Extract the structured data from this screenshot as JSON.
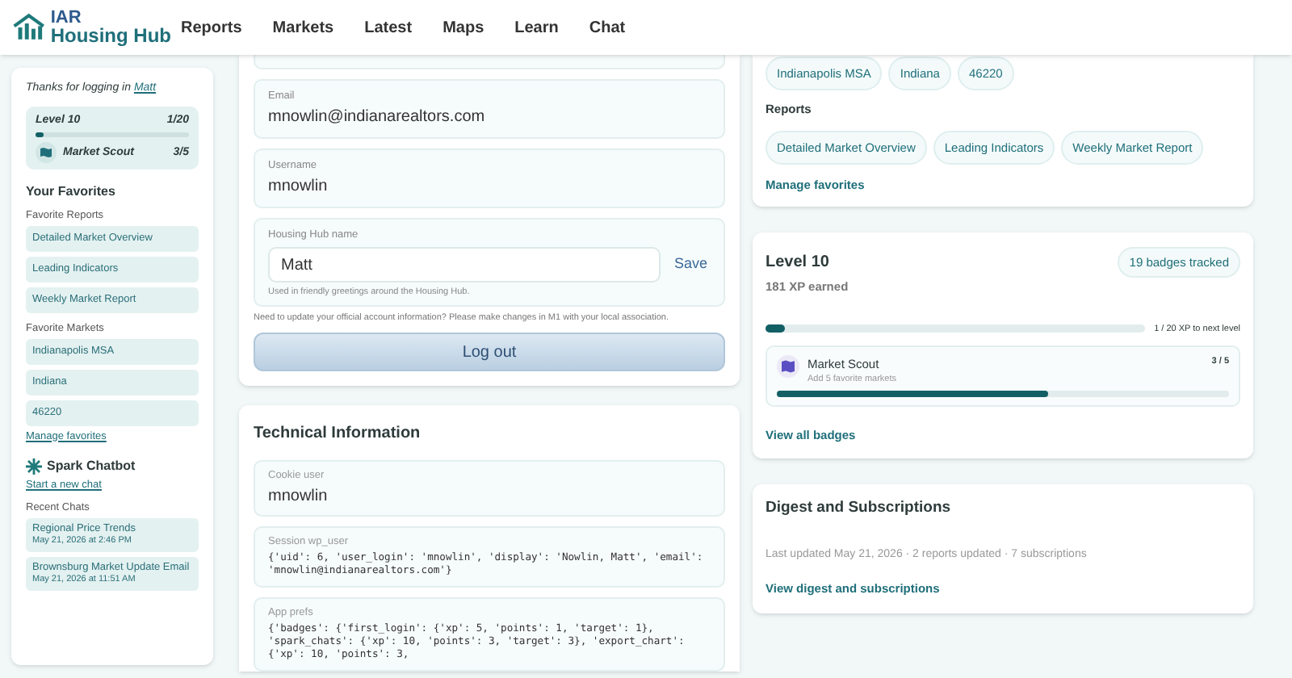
{
  "header": {
    "logo_top": "IAR",
    "logo_bottom": "Housing Hub",
    "nav": [
      {
        "label": "Reports"
      },
      {
        "label": "Markets"
      },
      {
        "label": "Latest"
      },
      {
        "label": "Maps"
      },
      {
        "label": "Learn"
      },
      {
        "label": "Chat"
      }
    ]
  },
  "sidebar": {
    "greeting": "Thanks for logging in",
    "user_link": "Matt",
    "level": {
      "title": "Level 10",
      "count": "1/20",
      "level": 0.05,
      "badge": "Market Scout",
      "badge_count": "3/5"
    },
    "favorites_title": "Your Favorites",
    "groups": [
      {
        "title": "Favorite Reports",
        "items": [
          "Detailed Market Overview",
          "Leading Indicators",
          "Weekly Market Report"
        ]
      },
      {
        "title": "Favorite Markets",
        "items": [
          "Indianapolis MSA",
          "Indiana",
          "46220"
        ]
      }
    ],
    "manage_link": "Manage favorites",
    "chatbot_title": "Spark Chatbot",
    "new_chat_link": "Start a new chat",
    "recent_title": "Recent Chats",
    "chats": [
      {
        "title": "Regional Price Trends",
        "date": "May 21, 2026 at 2:46 PM"
      },
      {
        "title": "Brownsburg Market Update Email",
        "date": "May 21, 2026 at 11:51 AM"
      }
    ]
  },
  "account": {
    "fields": [
      {
        "label": "Email",
        "value": "mnowlin@indianarealtors.com"
      },
      {
        "label": "Username",
        "value": "mnowlin"
      }
    ],
    "hub_name": {
      "label": "Housing Hub name",
      "value": "Matt",
      "save": "Save",
      "help": "Used in friendly greetings around the Housing Hub."
    },
    "note": "Need to update your official account information? Please make changes in M1 with your local association.",
    "logout": "Log out"
  },
  "technical": {
    "title": "Technical Information",
    "fields": [
      {
        "kind": "text",
        "label": "Cookie user",
        "value": "mnowlin"
      },
      {
        "kind": "code",
        "label": "Session wp_user",
        "value": "{'uid': 6, 'user_login': 'mnowlin', 'display': 'Nowlin, Matt', 'email': 'mnowlin@indianarealtors.com'}"
      },
      {
        "kind": "code",
        "label": "App prefs",
        "value": "{'badges': {'first_login': {'xp': 5, 'points': 1, 'target': 1}, 'spark_chats': {'xp': 10, 'points': 3, 'target': 3}, 'export_chart': {'xp': 10, 'points': 3,"
      }
    ]
  },
  "favorites_card": {
    "markets": [
      "Indianapolis MSA",
      "Indiana",
      "46220"
    ],
    "reports_label": "Reports",
    "reports": [
      "Detailed Market Overview",
      "Leading Indicators",
      "Weekly Market Report"
    ],
    "manage_link": "Manage favorites"
  },
  "level_card": {
    "title": "Level 10",
    "badges_tracked": "19 badges tracked",
    "xp": "181 XP earned",
    "level": 0.05,
    "next": "1 / 20 XP to next level",
    "badge": {
      "name": "Market Scout",
      "desc": "Add 5 favorite markets",
      "count": "3 / 5",
      "level": 0.6
    },
    "view_all": "View all badges"
  },
  "digest": {
    "title": "Digest and Subscriptions",
    "summary": "Last updated May 21, 2026 · 2 reports updated · 7 subscriptions",
    "link": "View digest and subscriptions"
  }
}
